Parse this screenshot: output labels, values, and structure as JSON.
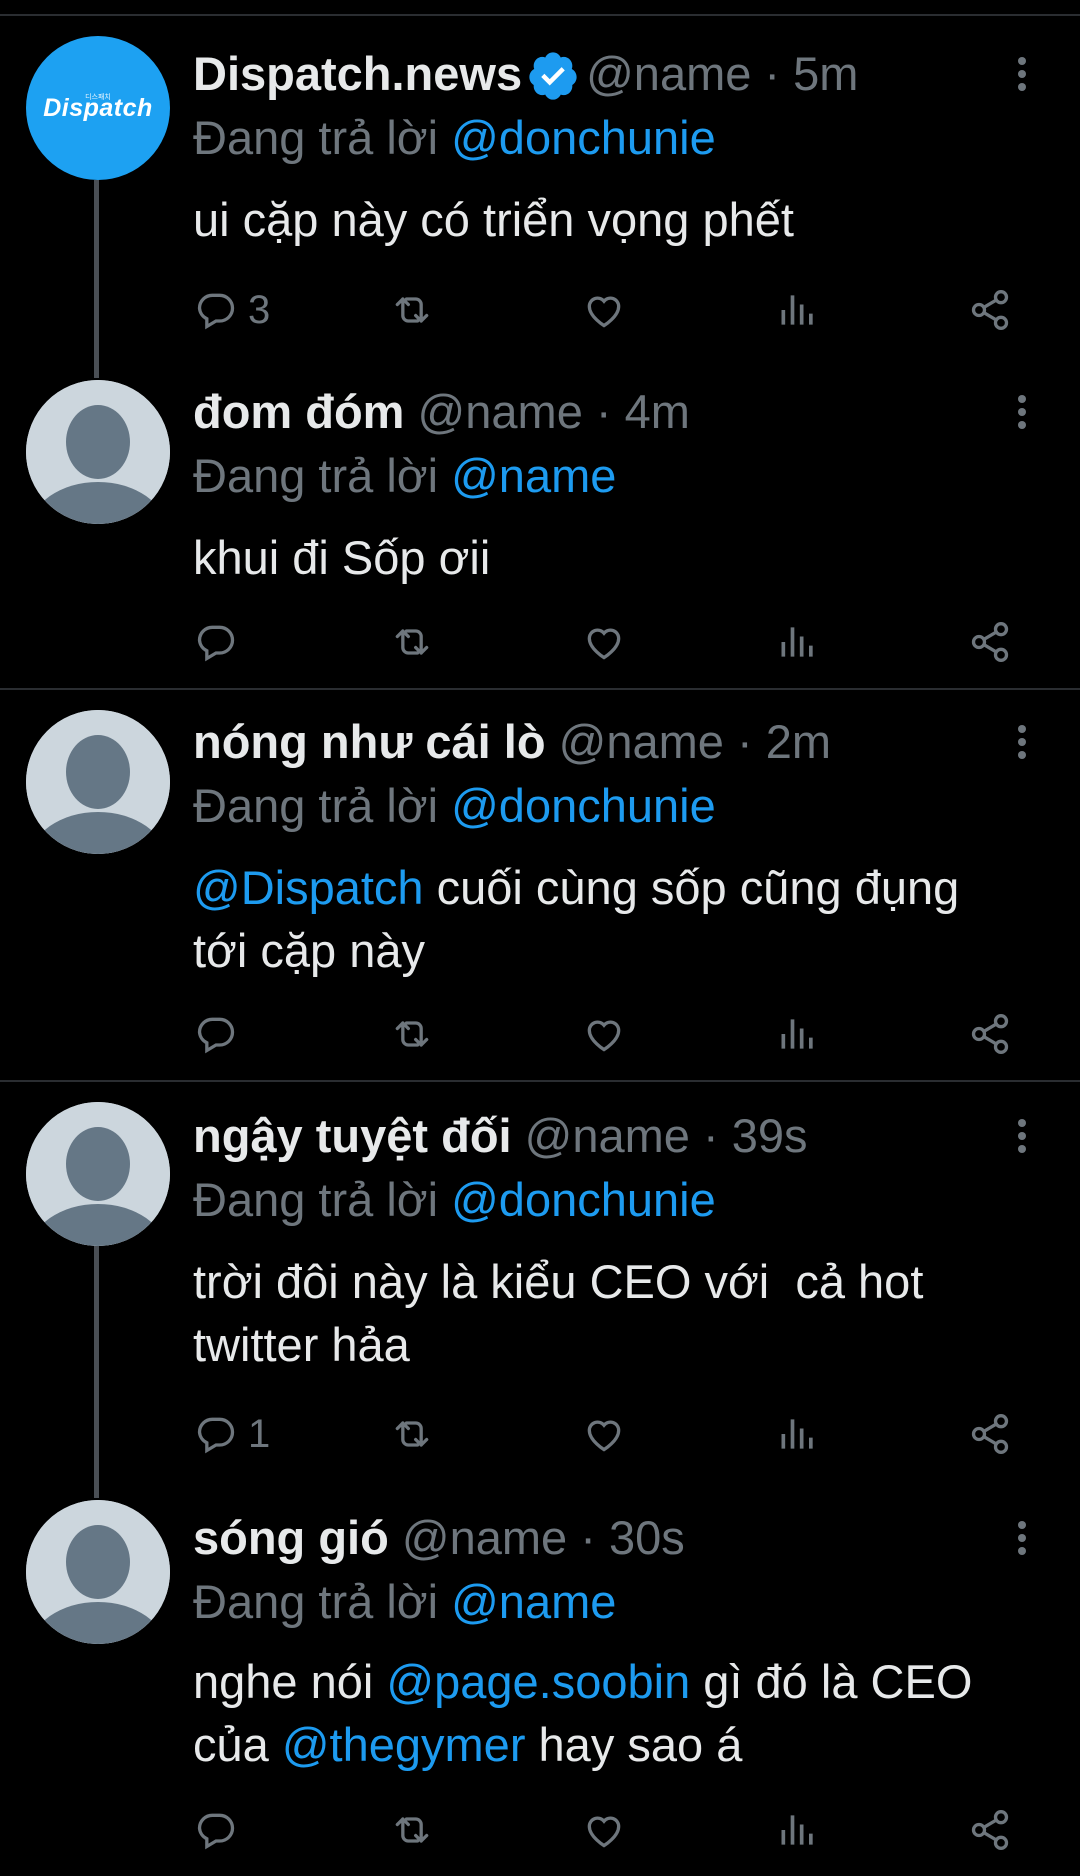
{
  "reply_prefix": "Đang trả lời",
  "tweets": [
    {
      "avatar_text": "Dispatch",
      "avatar_subtext": "디스패치",
      "name": "Dispatch.news",
      "verified": true,
      "handle": "@name",
      "time": "5m",
      "replying_to": "@donchunie",
      "body_parts": [
        {
          "text": "ui cặp này có triển vọng phết"
        }
      ],
      "reply_count": "3"
    },
    {
      "name": "đom đóm",
      "handle": "@name",
      "time": "4m",
      "replying_to": "@name",
      "body_parts": [
        {
          "text": "khui đi Sốp ơii"
        }
      ],
      "reply_count": ""
    },
    {
      "name": "nóng như cái lò",
      "handle": "@name",
      "time": "2m",
      "replying_to": "@donchunie",
      "body_parts": [
        {
          "text": "@Dispatch",
          "mention": true
        },
        {
          "text": " cuối cùng sốp cũng đụng tới cặp này"
        }
      ],
      "reply_count": ""
    },
    {
      "name": "ngậy tuyệt đối",
      "handle": "@name",
      "time": "39s",
      "replying_to": "@donchunie",
      "body_parts": [
        {
          "text": "trời đôi này là kiểu CEO với  cả hot twitter hảa"
        }
      ],
      "reply_count": "1"
    },
    {
      "name": "sóng gió",
      "handle": "@name",
      "time": "30s",
      "replying_to": "@name",
      "body_parts": [
        {
          "text": "nghe nói "
        },
        {
          "text": "@page.soobin",
          "mention": true
        },
        {
          "text": " gì đó là CEO của "
        },
        {
          "text": "@thegymer",
          "mention": true
        },
        {
          "text": " hay sao á"
        }
      ],
      "reply_count": ""
    }
  ],
  "colors": {
    "background": "#000000",
    "text": "#e7e9ea",
    "muted": "#6e767d",
    "mention": "#1d9bf0",
    "brand_avatar": "#1da1f2",
    "divider": "#2a2d31"
  },
  "icons": [
    "reply-icon",
    "retweet-icon",
    "like-icon",
    "analytics-icon",
    "share-icon",
    "more-icon",
    "verified-badge-icon"
  ]
}
